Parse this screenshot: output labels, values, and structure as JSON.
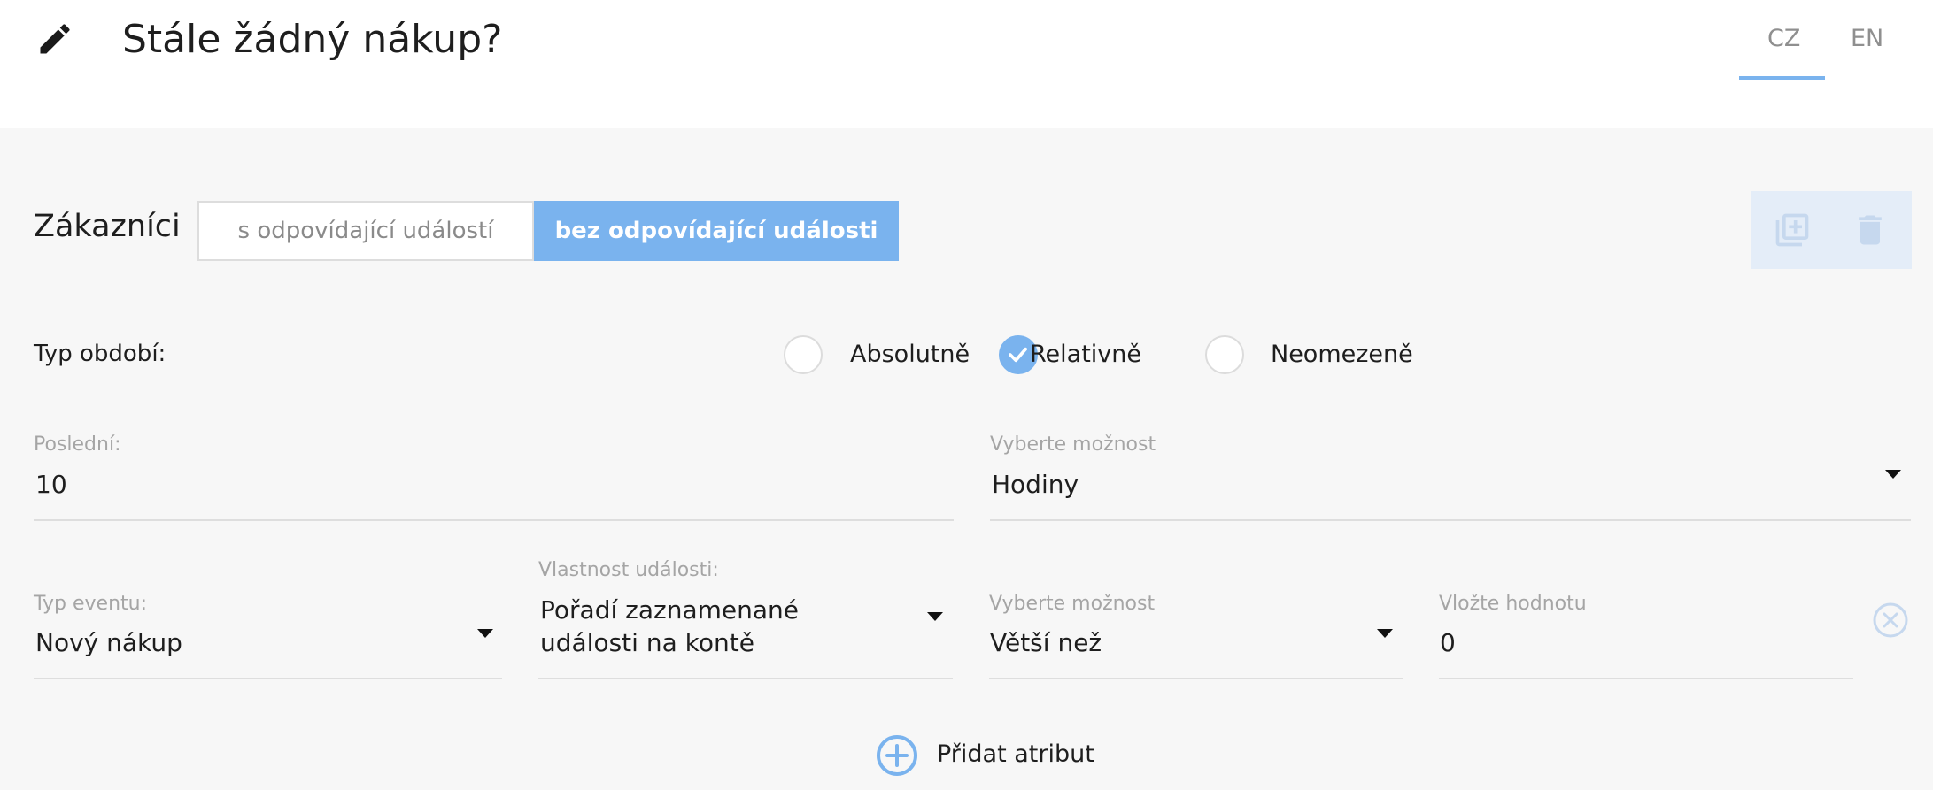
{
  "header": {
    "title": "Stále žádný nákup?",
    "edit_icon": "pencil-icon",
    "languages": [
      "CZ",
      "EN"
    ],
    "active_language": "CZ"
  },
  "customers": {
    "label": "Zákazníci",
    "options": [
      "s odpovídající událostí",
      "bez odpovídající události"
    ],
    "selected": "bez odpovídající události"
  },
  "actions": {
    "duplicate_icon": "copy-icon",
    "delete_icon": "trash-icon"
  },
  "period": {
    "label": "Typ období:",
    "options": [
      "Absolutně",
      "Relativně",
      "Neomezeně"
    ],
    "selected": "Relativně"
  },
  "last": {
    "label": "Poslední:",
    "value": "10"
  },
  "unit": {
    "label": "Vyberte možnost",
    "value": "Hodiny"
  },
  "condition": {
    "event_type_label": "Typ eventu:",
    "event_type_value": "Nový nákup",
    "property_label": "Vlastnost události:",
    "property_value_line1": "Pořadí zaznamenané",
    "property_value_line2": "události na kontě",
    "operator_label": "Vyberte možnost",
    "operator_value": "Větší než",
    "value_label": "Vložte hodnotu",
    "value": "0"
  },
  "add_attribute": {
    "label": "Přidat atribut",
    "icon": "plus-circle-icon"
  },
  "colors": {
    "accent": "#7ab3ee",
    "background": "#f7f7f7",
    "header_bg": "#ffffff"
  }
}
